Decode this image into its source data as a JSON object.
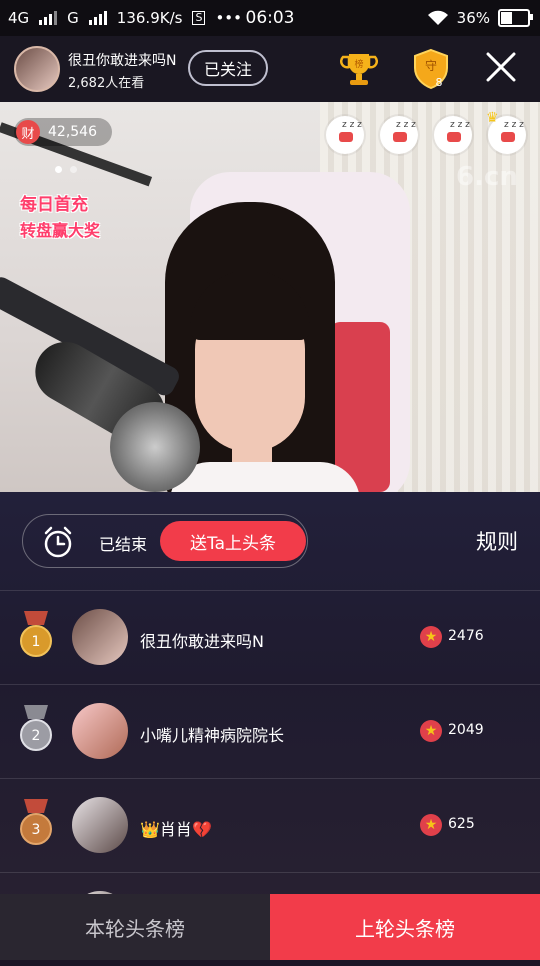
{
  "status_bar": {
    "network1": "4G",
    "network2": "G",
    "speed": "136.9K/s",
    "s_badge": "S",
    "more": "•••",
    "time": "06:03",
    "battery": "36%"
  },
  "header": {
    "streamer_name": "很丑你敢进来吗N",
    "viewers": "2,682人在看",
    "follow_label": "已关注",
    "trophy_label": "榜",
    "guard_label": "守",
    "guard_count": "8"
  },
  "video": {
    "wealth_badge": "财",
    "wealth_value": "42,546",
    "promo_line1": "每日首充",
    "promo_line2": "转盘赢大奖",
    "watermark": "6.cn",
    "top_viewers_zz": [
      "z z z",
      "z z z",
      "z z z",
      "z z z"
    ]
  },
  "headline_panel": {
    "status_text": "已结束",
    "send_button": "送Ta上头条",
    "rules_label": "规则"
  },
  "ranking": [
    {
      "rank": "1",
      "name": "很丑你敢进来吗N",
      "score": "2476",
      "medal_color": "#d99a2b",
      "ring": "#f2c25a"
    },
    {
      "rank": "2",
      "name": "小嘴儿精神病院院长",
      "score": "2049",
      "medal_color": "#9c9ca4",
      "ring": "#e0e0e6"
    },
    {
      "rank": "3",
      "name": "肖肖",
      "score": "625",
      "medal_color": "#c47a3c",
      "ring": "#e3a56a",
      "prefix": "👑",
      "suffix": "💔"
    }
  ],
  "tabs": {
    "current": "本轮头条榜",
    "previous": "上轮头条榜"
  }
}
